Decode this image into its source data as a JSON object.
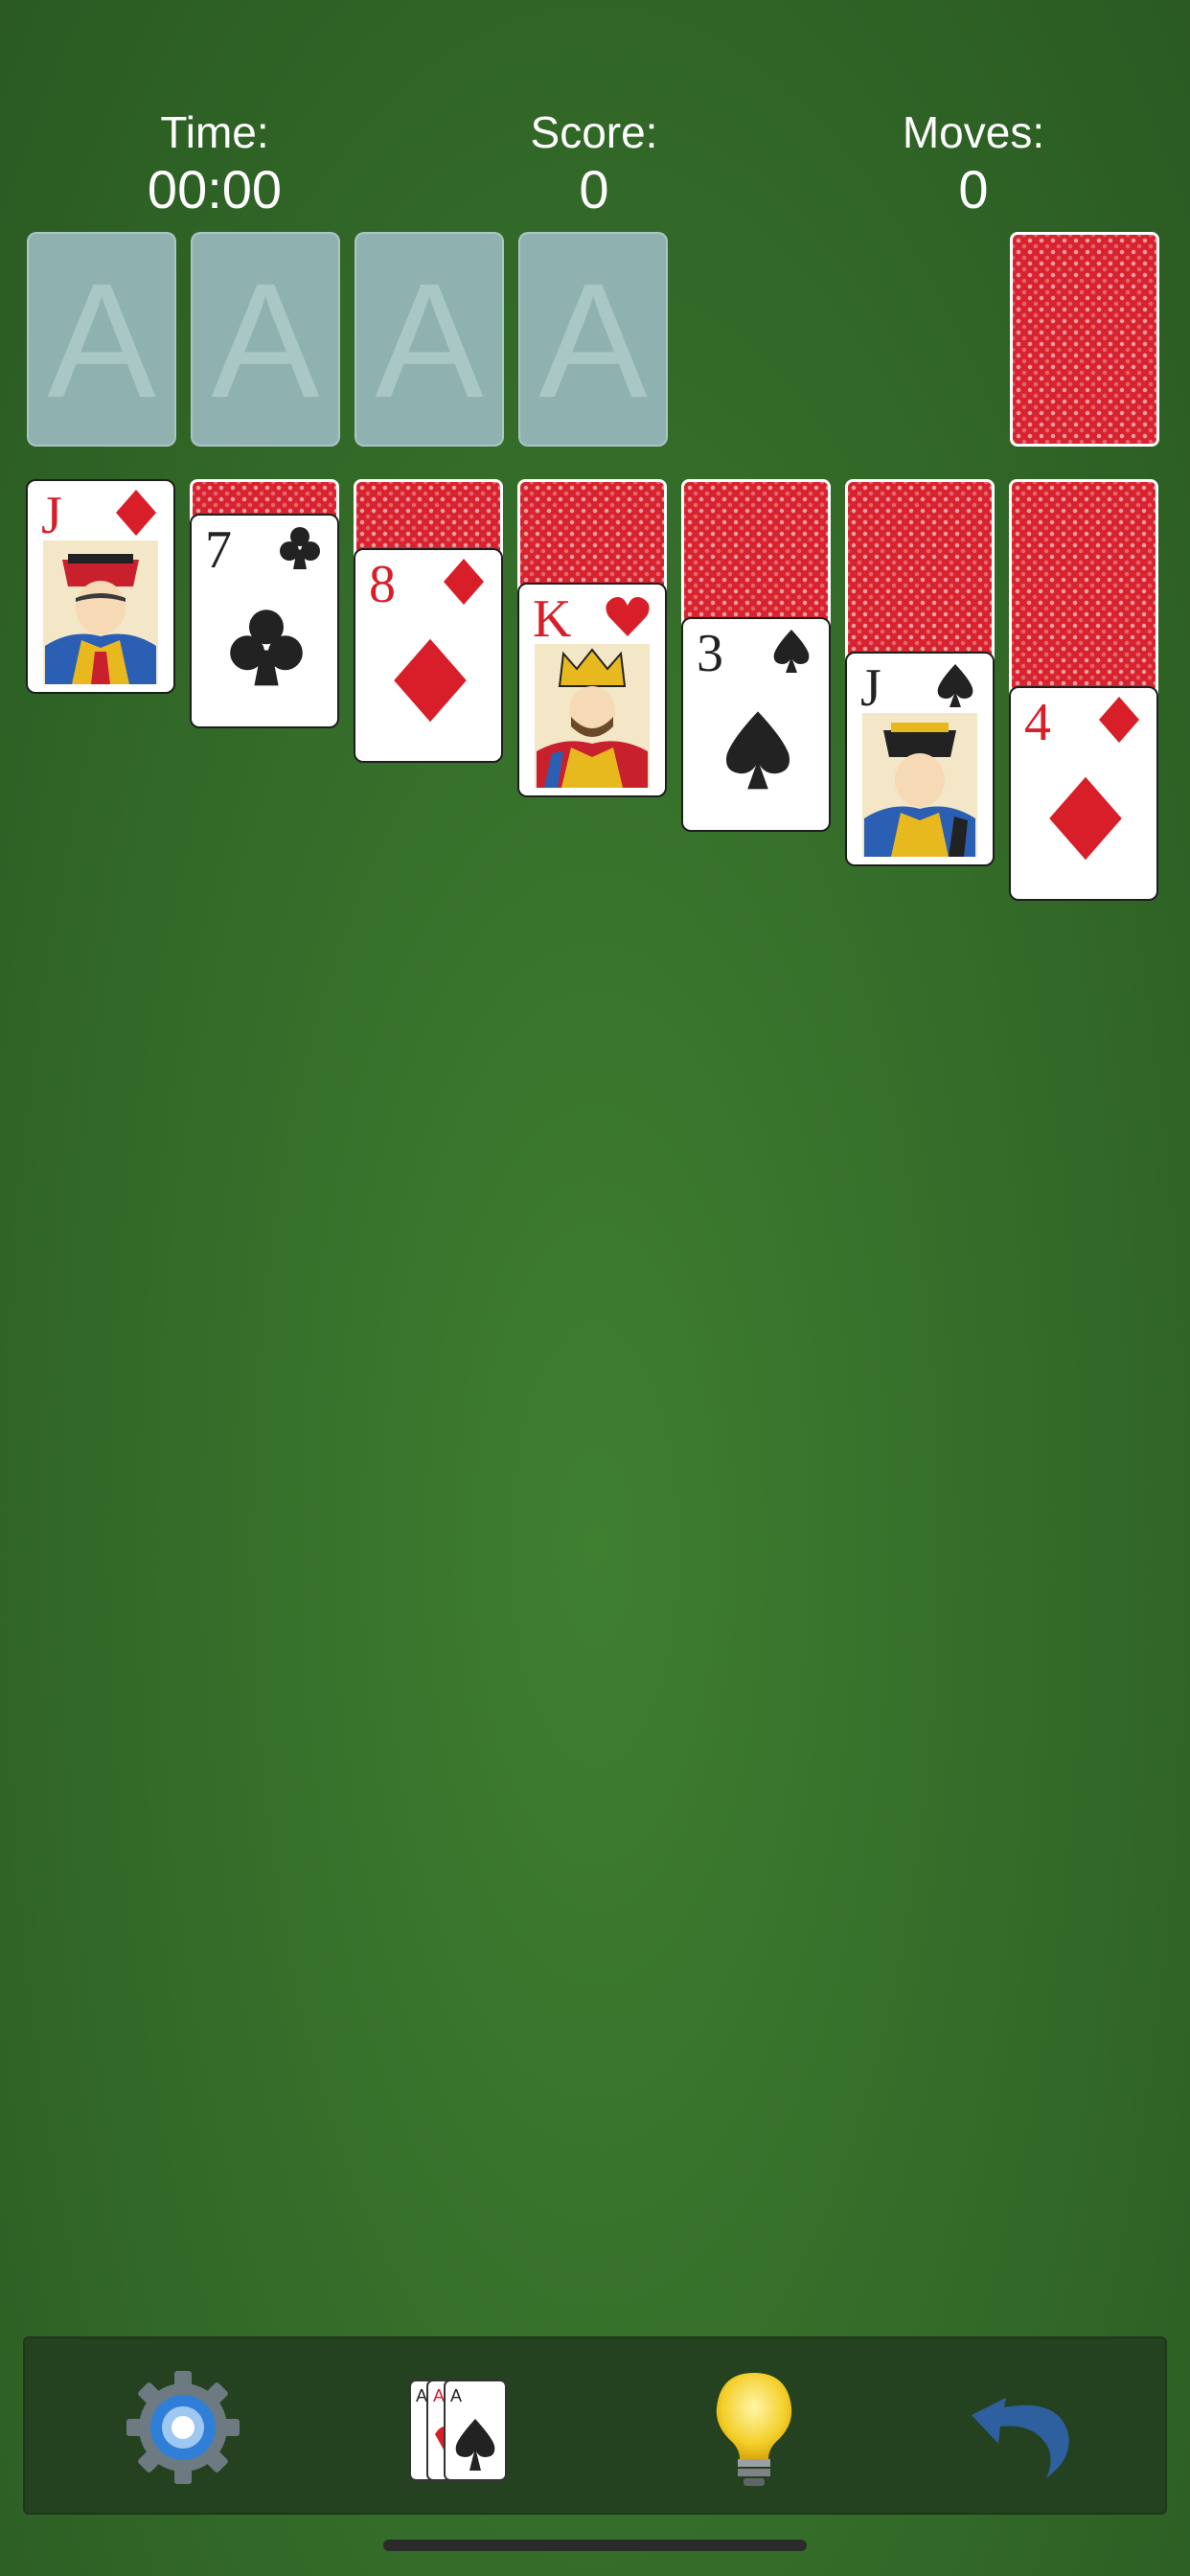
{
  "hud": {
    "time_label": "Time:",
    "time_value": "00:00",
    "score_label": "Score:",
    "score_value": "0",
    "moves_label": "Moves:",
    "moves_value": "0"
  },
  "foundations": [
    {
      "placeholder": "A"
    },
    {
      "placeholder": "A"
    },
    {
      "placeholder": "A"
    },
    {
      "placeholder": "A"
    }
  ],
  "stock": {
    "state": "face-down"
  },
  "tableau": [
    {
      "hidden": 0,
      "top": {
        "rank": "J",
        "suit": "diamonds",
        "color": "red"
      }
    },
    {
      "hidden": 1,
      "top": {
        "rank": "7",
        "suit": "clubs",
        "color": "black"
      }
    },
    {
      "hidden": 2,
      "top": {
        "rank": "8",
        "suit": "diamonds",
        "color": "red"
      }
    },
    {
      "hidden": 3,
      "top": {
        "rank": "K",
        "suit": "hearts",
        "color": "red"
      }
    },
    {
      "hidden": 4,
      "top": {
        "rank": "3",
        "suit": "spades",
        "color": "black"
      }
    },
    {
      "hidden": 5,
      "top": {
        "rank": "J",
        "suit": "spades",
        "color": "black"
      }
    },
    {
      "hidden": 6,
      "top": {
        "rank": "4",
        "suit": "diamonds",
        "color": "red"
      }
    }
  ],
  "toolbar": {
    "buttons": [
      {
        "icon": "gear-icon"
      },
      {
        "icon": "cards-icon"
      },
      {
        "icon": "lightbulb-icon"
      },
      {
        "icon": "undo-arrow-icon"
      }
    ]
  },
  "colors": {
    "felt": "#3a7a2e",
    "card_back": "#d8232f",
    "red_suit": "#d81e28",
    "black_suit": "#222222",
    "foundation": "#8fb2b0",
    "toolbar": "#24421f"
  }
}
